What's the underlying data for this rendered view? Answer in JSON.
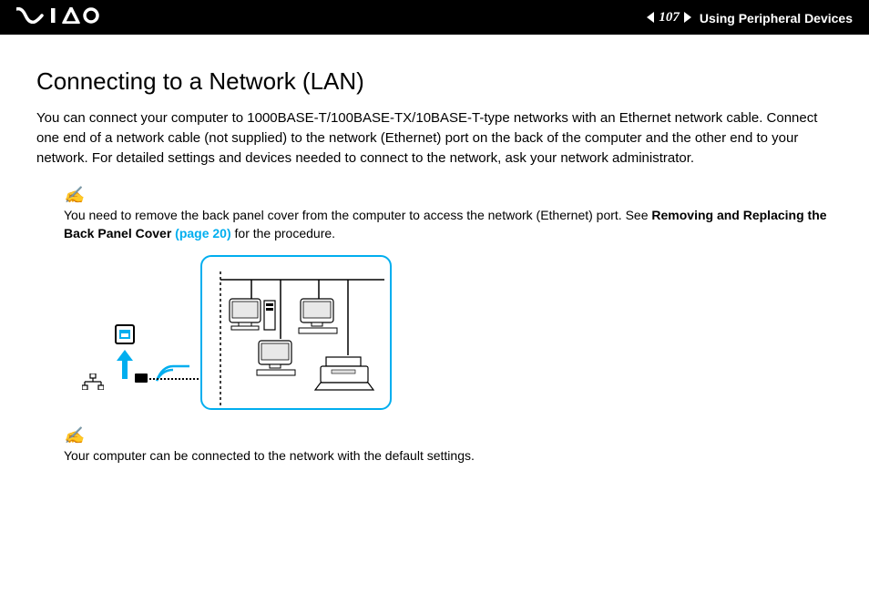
{
  "header": {
    "page_number": "107",
    "section": "Using Peripheral Devices"
  },
  "main": {
    "title": "Connecting to a Network (LAN)",
    "intro": "You can connect your computer to 1000BASE-T/100BASE-TX/10BASE-T-type networks with an Ethernet network cable. Connect one end of a network cable (not supplied) to the network (Ethernet) port on the back of the computer and the other end to your network. For detailed settings and devices needed to connect to the network, ask your network administrator.",
    "note1_pre": "You need to remove the back panel cover from the computer to access the network (Ethernet) port. See ",
    "note1_bold": "Removing and Replacing the Back Panel Cover ",
    "note1_link": "(page 20)",
    "note1_post": " for the procedure.",
    "note2": "Your computer can be connected to the network with the default settings."
  }
}
